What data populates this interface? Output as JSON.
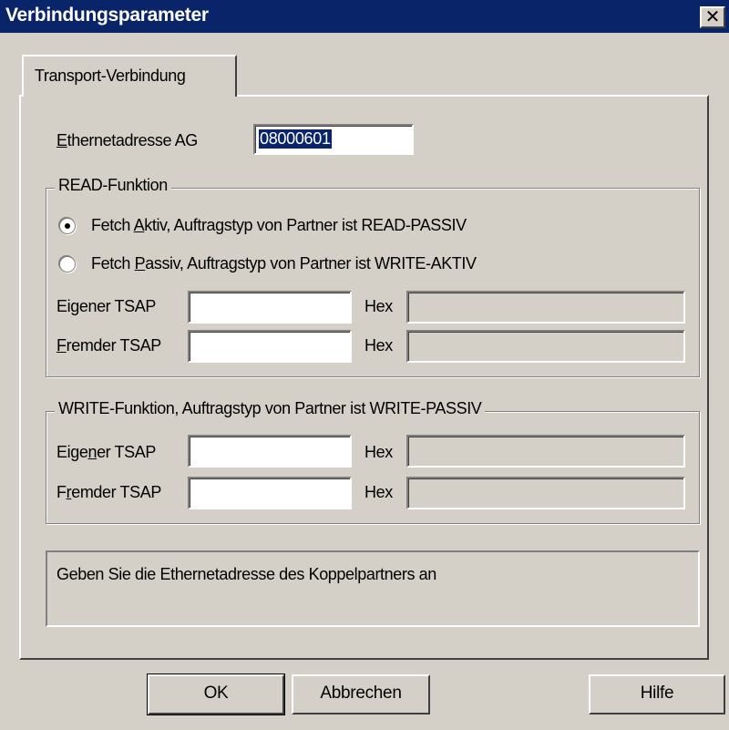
{
  "window": {
    "title": "Verbindungsparameter",
    "close_glyph": "✕"
  },
  "tabs": [
    {
      "label": "Transport-Verbindung",
      "selected": true
    }
  ],
  "ethernet": {
    "label_mnemonic": "E",
    "label_rest": "thernetadresse AG",
    "value": "08000601"
  },
  "read_group": {
    "legend": "READ-Funktion",
    "radio_active": {
      "pre": "Fetch ",
      "mnemonic": "A",
      "post": "ktiv,   Auftragstyp von Partner ist READ-PASSIV",
      "checked": true
    },
    "radio_passive": {
      "pre": "Fetch ",
      "mnemonic": "P",
      "post": "assiv, Auftragstyp von Partner ist WRITE-AKTIV",
      "checked": false
    },
    "own_tsap": {
      "pre": "Ei",
      "mnemonic": "g",
      "post": "ener TSAP",
      "value": "",
      "hex_label": "Hex",
      "hex_value": ""
    },
    "remote_tsap": {
      "pre": "",
      "mnemonic": "F",
      "post": "remder TSAP",
      "value": "",
      "hex_label": "Hex",
      "hex_value": ""
    }
  },
  "write_group": {
    "legend": "WRITE-Funktion, Auftragstyp von Partner ist WRITE-PASSIV",
    "own_tsap": {
      "pre": "Eige",
      "mnemonic": "n",
      "post": "er TSAP",
      "value": "",
      "hex_label": "Hex",
      "hex_value": ""
    },
    "remote_tsap": {
      "pre": "F",
      "mnemonic": "r",
      "post": "emder TSAP",
      "value": "",
      "hex_label": "Hex",
      "hex_value": ""
    }
  },
  "info": {
    "text": "Geben Sie die Ethernetadresse des Koppelpartners an"
  },
  "buttons": {
    "ok": "OK",
    "cancel": "Abbrechen",
    "help": "Hilfe"
  },
  "colors": {
    "titlebar": "#0a246a",
    "face": "#d4d0c8",
    "selection": "#0a246a"
  }
}
